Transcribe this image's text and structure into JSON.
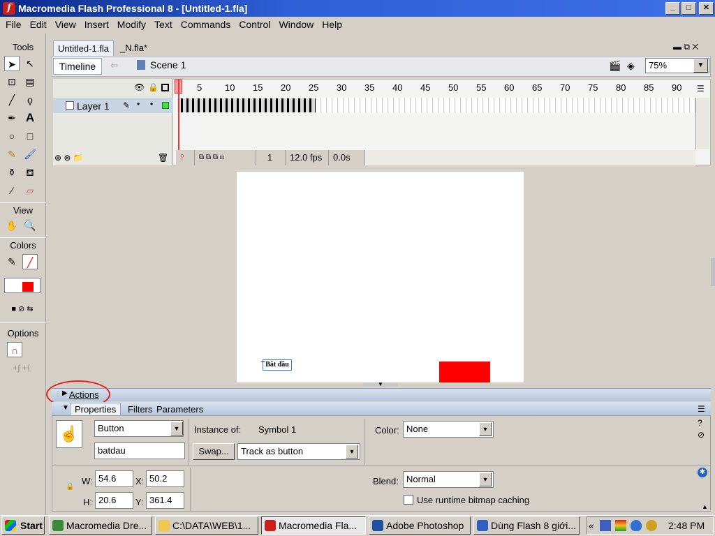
{
  "window": {
    "title": "Macromedia Flash Professional 8 - [Untitled-1.fla]",
    "min": "_",
    "max": "□",
    "close": "✕"
  },
  "menu": [
    "File",
    "Edit",
    "View",
    "Insert",
    "Modify",
    "Text",
    "Commands",
    "Control",
    "Window",
    "Help"
  ],
  "tools": {
    "title": "Tools",
    "view_title": "View",
    "colors_title": "Colors",
    "options_title": "Options"
  },
  "doc_tabs": [
    "Untitled-1.fla",
    "_N.fla*"
  ],
  "timeline": {
    "button": "Timeline",
    "scene": "Scene 1",
    "zoom": "75%",
    "ruler": [
      "1",
      "5",
      "10",
      "15",
      "20",
      "25",
      "30",
      "35",
      "40",
      "45",
      "50",
      "55",
      "60",
      "65",
      "70",
      "75",
      "80",
      "85",
      "90"
    ],
    "layer_name": "Layer 1",
    "frame": "1",
    "fps": "12.0 fps",
    "time": "0.0s"
  },
  "stage": {
    "button_text": "Bắt đầu"
  },
  "actions": {
    "label": "Actions"
  },
  "properties": {
    "tabs": [
      "Properties",
      "Filters",
      "Parameters"
    ],
    "type": "Button",
    "instance_name": "batdau",
    "instance_of_label": "Instance of:",
    "symbol": "Symbol 1",
    "swap": "Swap...",
    "track": "Track as button",
    "color_label": "Color:",
    "color_value": "None",
    "w_label": "W:",
    "w": "54.6",
    "h_label": "H:",
    "h": "20.6",
    "x_label": "X:",
    "x": "50.2",
    "y_label": "Y:",
    "y": "361.4",
    "blend_label": "Blend:",
    "blend_value": "Normal",
    "cache_label": "Use runtime bitmap caching"
  },
  "taskbar": {
    "start": "Start",
    "tasks": [
      "Macromedia Dre...",
      "C:\\DATA\\WEB\\1...",
      "Macromedia Fla...",
      "Adobe Photoshop",
      "Dùng Flash 8 giới..."
    ],
    "clock": "2:48 PM",
    "tray_chevron": "«"
  }
}
